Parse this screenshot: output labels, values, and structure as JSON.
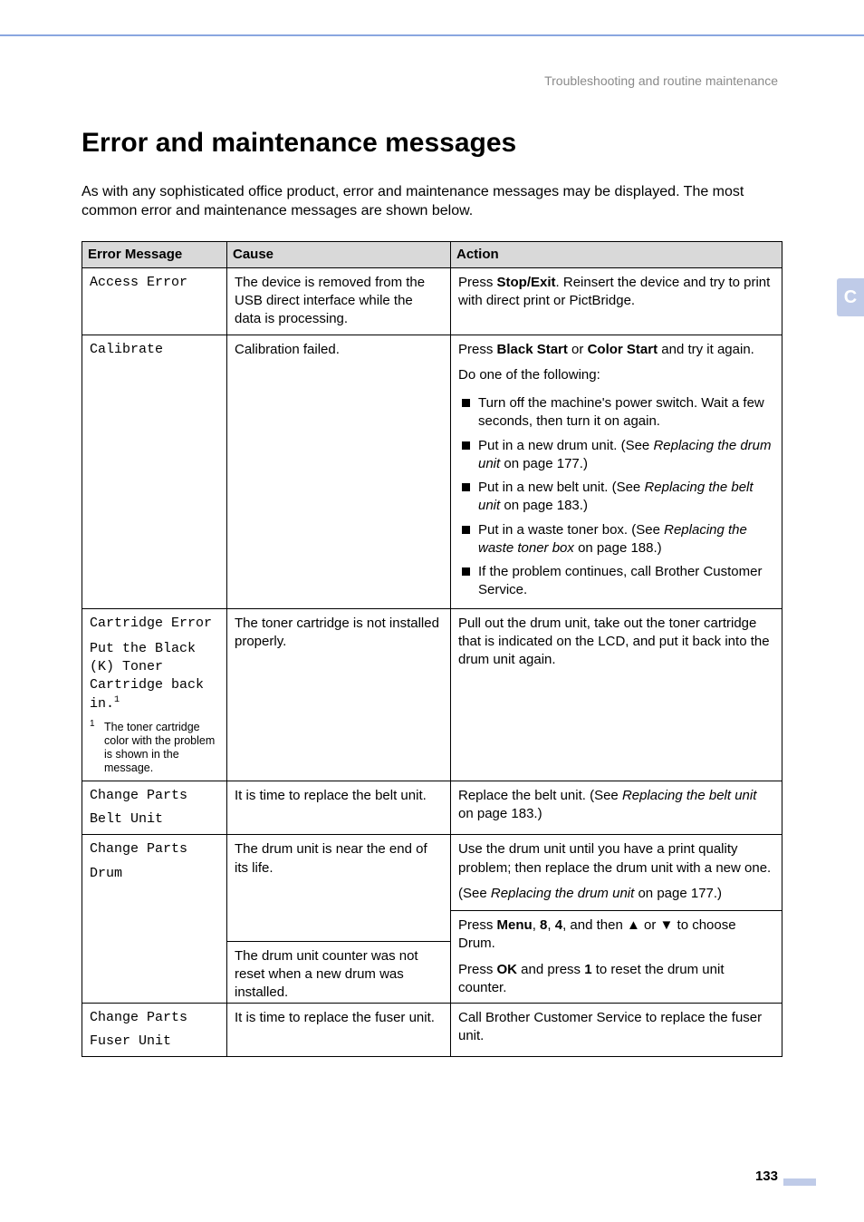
{
  "header": {
    "subtitle": "Troubleshooting and routine maintenance"
  },
  "thumb": {
    "letter": "C"
  },
  "title": "Error and maintenance messages",
  "intro": "As with any sophisticated office product, error and maintenance messages may be displayed. The most common error and maintenance messages are shown below.",
  "table": {
    "headers": {
      "col1": "Error Message",
      "col2": "Cause",
      "col3": "Action"
    },
    "rows": {
      "access": {
        "msg": "Access Error",
        "cause": "The device is removed from the USB direct interface while the data is processing.",
        "action_pre": "Press ",
        "action_b1": "Stop/Exit",
        "action_post": ". Reinsert the device and try to print with direct print or PictBridge."
      },
      "calibrate": {
        "msg": "Calibrate",
        "cause": "Calibration failed.",
        "a_press": "Press ",
        "a_b1": "Black Start",
        "a_or": " or ",
        "a_b2": "Color Start",
        "a_tryagain": " and try it again.",
        "do_one": "Do one of the following:",
        "li1": "Turn off the machine's power switch. Wait a few seconds, then turn it on again.",
        "li2a": "Put in a new drum unit. (See ",
        "li2i": "Replacing the drum unit",
        "li2b": " on page 177.)",
        "li3a": "Put in a new belt unit. (See ",
        "li3i": "Replacing the belt unit",
        "li3b": " on page 183.)",
        "li4a": "Put in a waste toner box. (See ",
        "li4i": "Replacing the waste toner box",
        "li4b": " on page 188.)",
        "li5": "If the problem continues, call Brother Customer Service."
      },
      "cartridge": {
        "msg_top": "Cartridge Error",
        "msg_l1": "Put the Black (K) Toner Cartridge back in.",
        "note_sup": "1",
        "note_body": "The toner cartridge color with the problem is shown in the message.",
        "cause": "The toner cartridge is not installed properly.",
        "action": "Pull out the drum unit, take out the toner cartridge that is indicated on the LCD, and put it back into the drum unit again."
      },
      "belt": {
        "msg_l1": "Change Parts",
        "msg_l2": "Belt Unit",
        "cause": "It is time to replace the belt unit.",
        "action_a": "Replace the belt unit. (See ",
        "action_i": "Replacing the belt unit",
        "action_b": " on page 183.)"
      },
      "drum": {
        "msg_l1": "Change Parts",
        "msg_l2": "Drum",
        "cause1": "The drum unit is near the end of its life.",
        "a1": "Use the drum unit until you have a print quality problem; then replace the drum unit with a new one.",
        "a1b_a": "(See ",
        "a1b_i": "Replacing the drum unit",
        "a1b_b": " on page 177.)",
        "cause2": "The drum unit counter was not reset when a new drum was installed.",
        "a2_pre": "Press ",
        "a2_menu": "Menu",
        "a2_c1": ", ",
        "a2_8": "8",
        "a2_c2": ", ",
        "a2_4": "4",
        "a2_mid": ", and then ",
        "a2_up": "▲",
        "a2_or": " or ",
        "a2_down": "▼",
        "a2_post": " to choose Drum.",
        "a3_pre": "Press ",
        "a3_ok": "OK",
        "a3_mid": " and press ",
        "a3_1": "1",
        "a3_post": " to reset the drum unit counter."
      },
      "fuser": {
        "msg_l1": "Change Parts",
        "msg_l2": "Fuser Unit",
        "cause": "It is time to replace the fuser unit.",
        "action": "Call Brother Customer Service to replace the fuser unit."
      }
    }
  },
  "page_number": "133"
}
